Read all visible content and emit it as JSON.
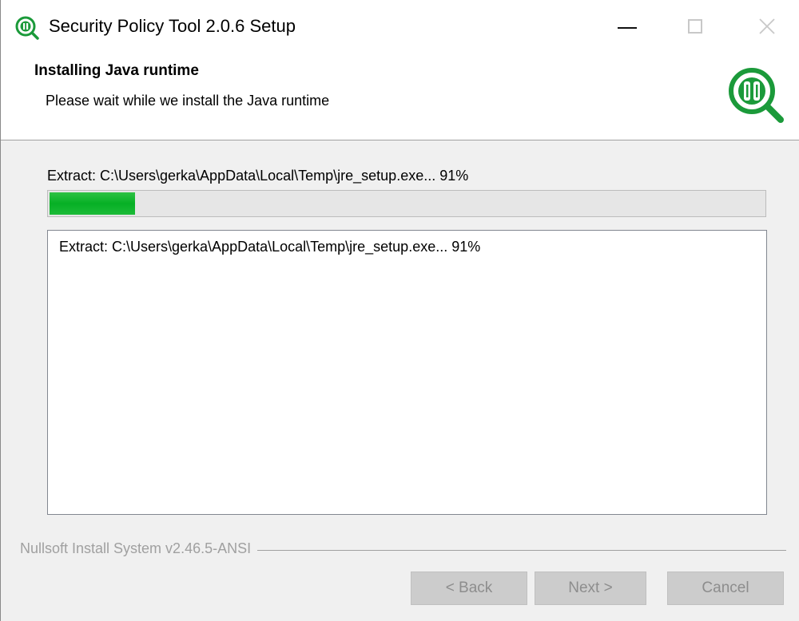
{
  "window": {
    "title": "Security Policy Tool 2.0.6 Setup",
    "icon": "security-policy-tool-icon"
  },
  "header": {
    "title": "Installing Java runtime",
    "subtitle": "Please wait while we install the Java runtime",
    "logo_icon": "security-policy-tool-logo"
  },
  "status": {
    "text": "Extract: C:\\Users\\gerka\\AppData\\Local\\Temp\\jre_setup.exe... 91%"
  },
  "progress": {
    "value": 0.12,
    "color": "#06b025"
  },
  "log": {
    "lines": [
      "Extract: C:\\Users\\gerka\\AppData\\Local\\Temp\\jre_setup.exe... 91%"
    ]
  },
  "branding": "Nullsoft Install System v2.46.5-ANSI",
  "buttons": {
    "back": "< Back",
    "next": "Next >",
    "cancel": "Cancel"
  },
  "colors": {
    "accent_green": "#1b9a3a",
    "disabled_text": "#8d8d8d"
  }
}
